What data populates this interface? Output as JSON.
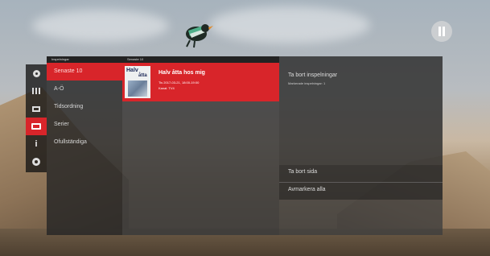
{
  "colors": {
    "accent": "#d8252a",
    "panel": "#262626"
  },
  "top": {
    "settings_icon": "pause-bars-icon",
    "mascot_icon": "bird-icon"
  },
  "iconbar": {
    "items": [
      {
        "icon": "record-circle-icon",
        "active": false
      },
      {
        "icon": "grid-icon",
        "active": false
      },
      {
        "icon": "tv-icon",
        "active": false
      },
      {
        "icon": "folder-icon",
        "active": true
      },
      {
        "icon": "info-icon",
        "active": false
      },
      {
        "icon": "gear-icon",
        "active": false
      }
    ],
    "info_glyph": "i"
  },
  "headers": {
    "menu": "Inspelningar",
    "list": "Senaste 10"
  },
  "menu": {
    "items": [
      {
        "label": "Senaste 10",
        "active": true
      },
      {
        "label": "A-Ö",
        "active": false
      },
      {
        "label": "Tidsordning",
        "active": false
      },
      {
        "label": "Serier",
        "active": false
      },
      {
        "label": "Ofullständiga",
        "active": false
      }
    ]
  },
  "recording": {
    "thumb_line1": "Halv",
    "thumb_line2": "åtta",
    "title": "Halv åtta hos mig",
    "time": "Tis 2017-03-21, 18:00-19:00",
    "channel": "Kanal: TV4"
  },
  "detail": {
    "delete_label": "Ta bort inspelningar",
    "marked_label": "Markerade inspelningar: 1",
    "remove_page_label": "Ta bort sida",
    "mark_all_label": "Avmarkera alla"
  }
}
